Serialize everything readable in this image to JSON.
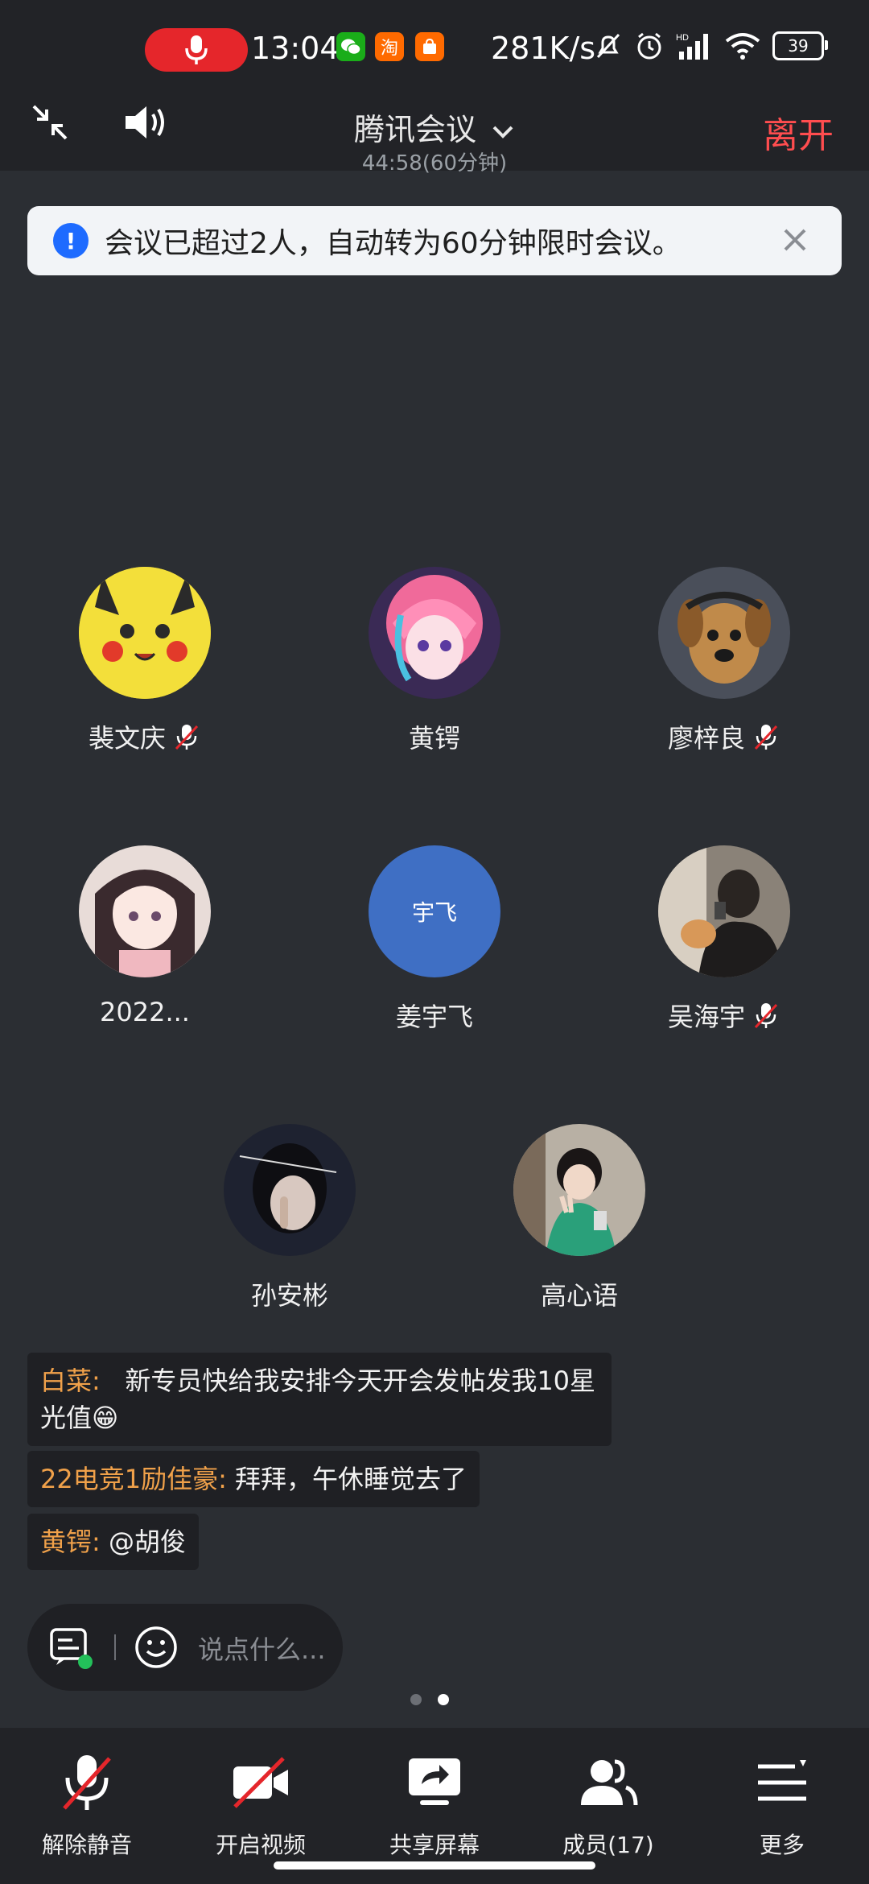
{
  "status_bar": {
    "time": "13:04",
    "net_speed": "281K/s",
    "battery": "39",
    "app_icon_taobao": "淘"
  },
  "header": {
    "title": "腾讯会议",
    "timer": "44:58(60分钟)",
    "leave_label": "离开"
  },
  "notice": {
    "text": "会议已超过2人，自动转为60分钟限时会议。"
  },
  "participants": [
    {
      "name": "裴文庆",
      "muted": true
    },
    {
      "name": "黄锷",
      "muted": false
    },
    {
      "name": "廖梓良",
      "muted": true
    },
    {
      "name": "2022...",
      "muted": false
    },
    {
      "name": "姜宇飞",
      "muted": false,
      "avatar_text": "宇飞"
    },
    {
      "name": "吴海宇",
      "muted": true
    },
    {
      "name": "孙安彬",
      "muted": false
    },
    {
      "name": "高心语",
      "muted": false
    }
  ],
  "chat": [
    {
      "sender": "白菜:",
      "text": "新专员快给我安排今天开会发帖发我10星光值😁"
    },
    {
      "sender": "22电竞1励佳豪:",
      "text": "拜拜，午休睡觉去了"
    },
    {
      "sender": "黄锷:",
      "text": "@胡俊"
    }
  ],
  "input": {
    "placeholder": "说点什么..."
  },
  "toolbar": {
    "unmute": "解除静音",
    "video": "开启视频",
    "share": "共享屏幕",
    "members": "成员(17)",
    "more": "更多"
  },
  "colors": {
    "background": "#2b2e33",
    "bar": "#222327",
    "leave": "#ff4d4f",
    "sender": "#f0a14a",
    "notice_icon": "#1e6bff",
    "mute_red": "#e5262b"
  }
}
